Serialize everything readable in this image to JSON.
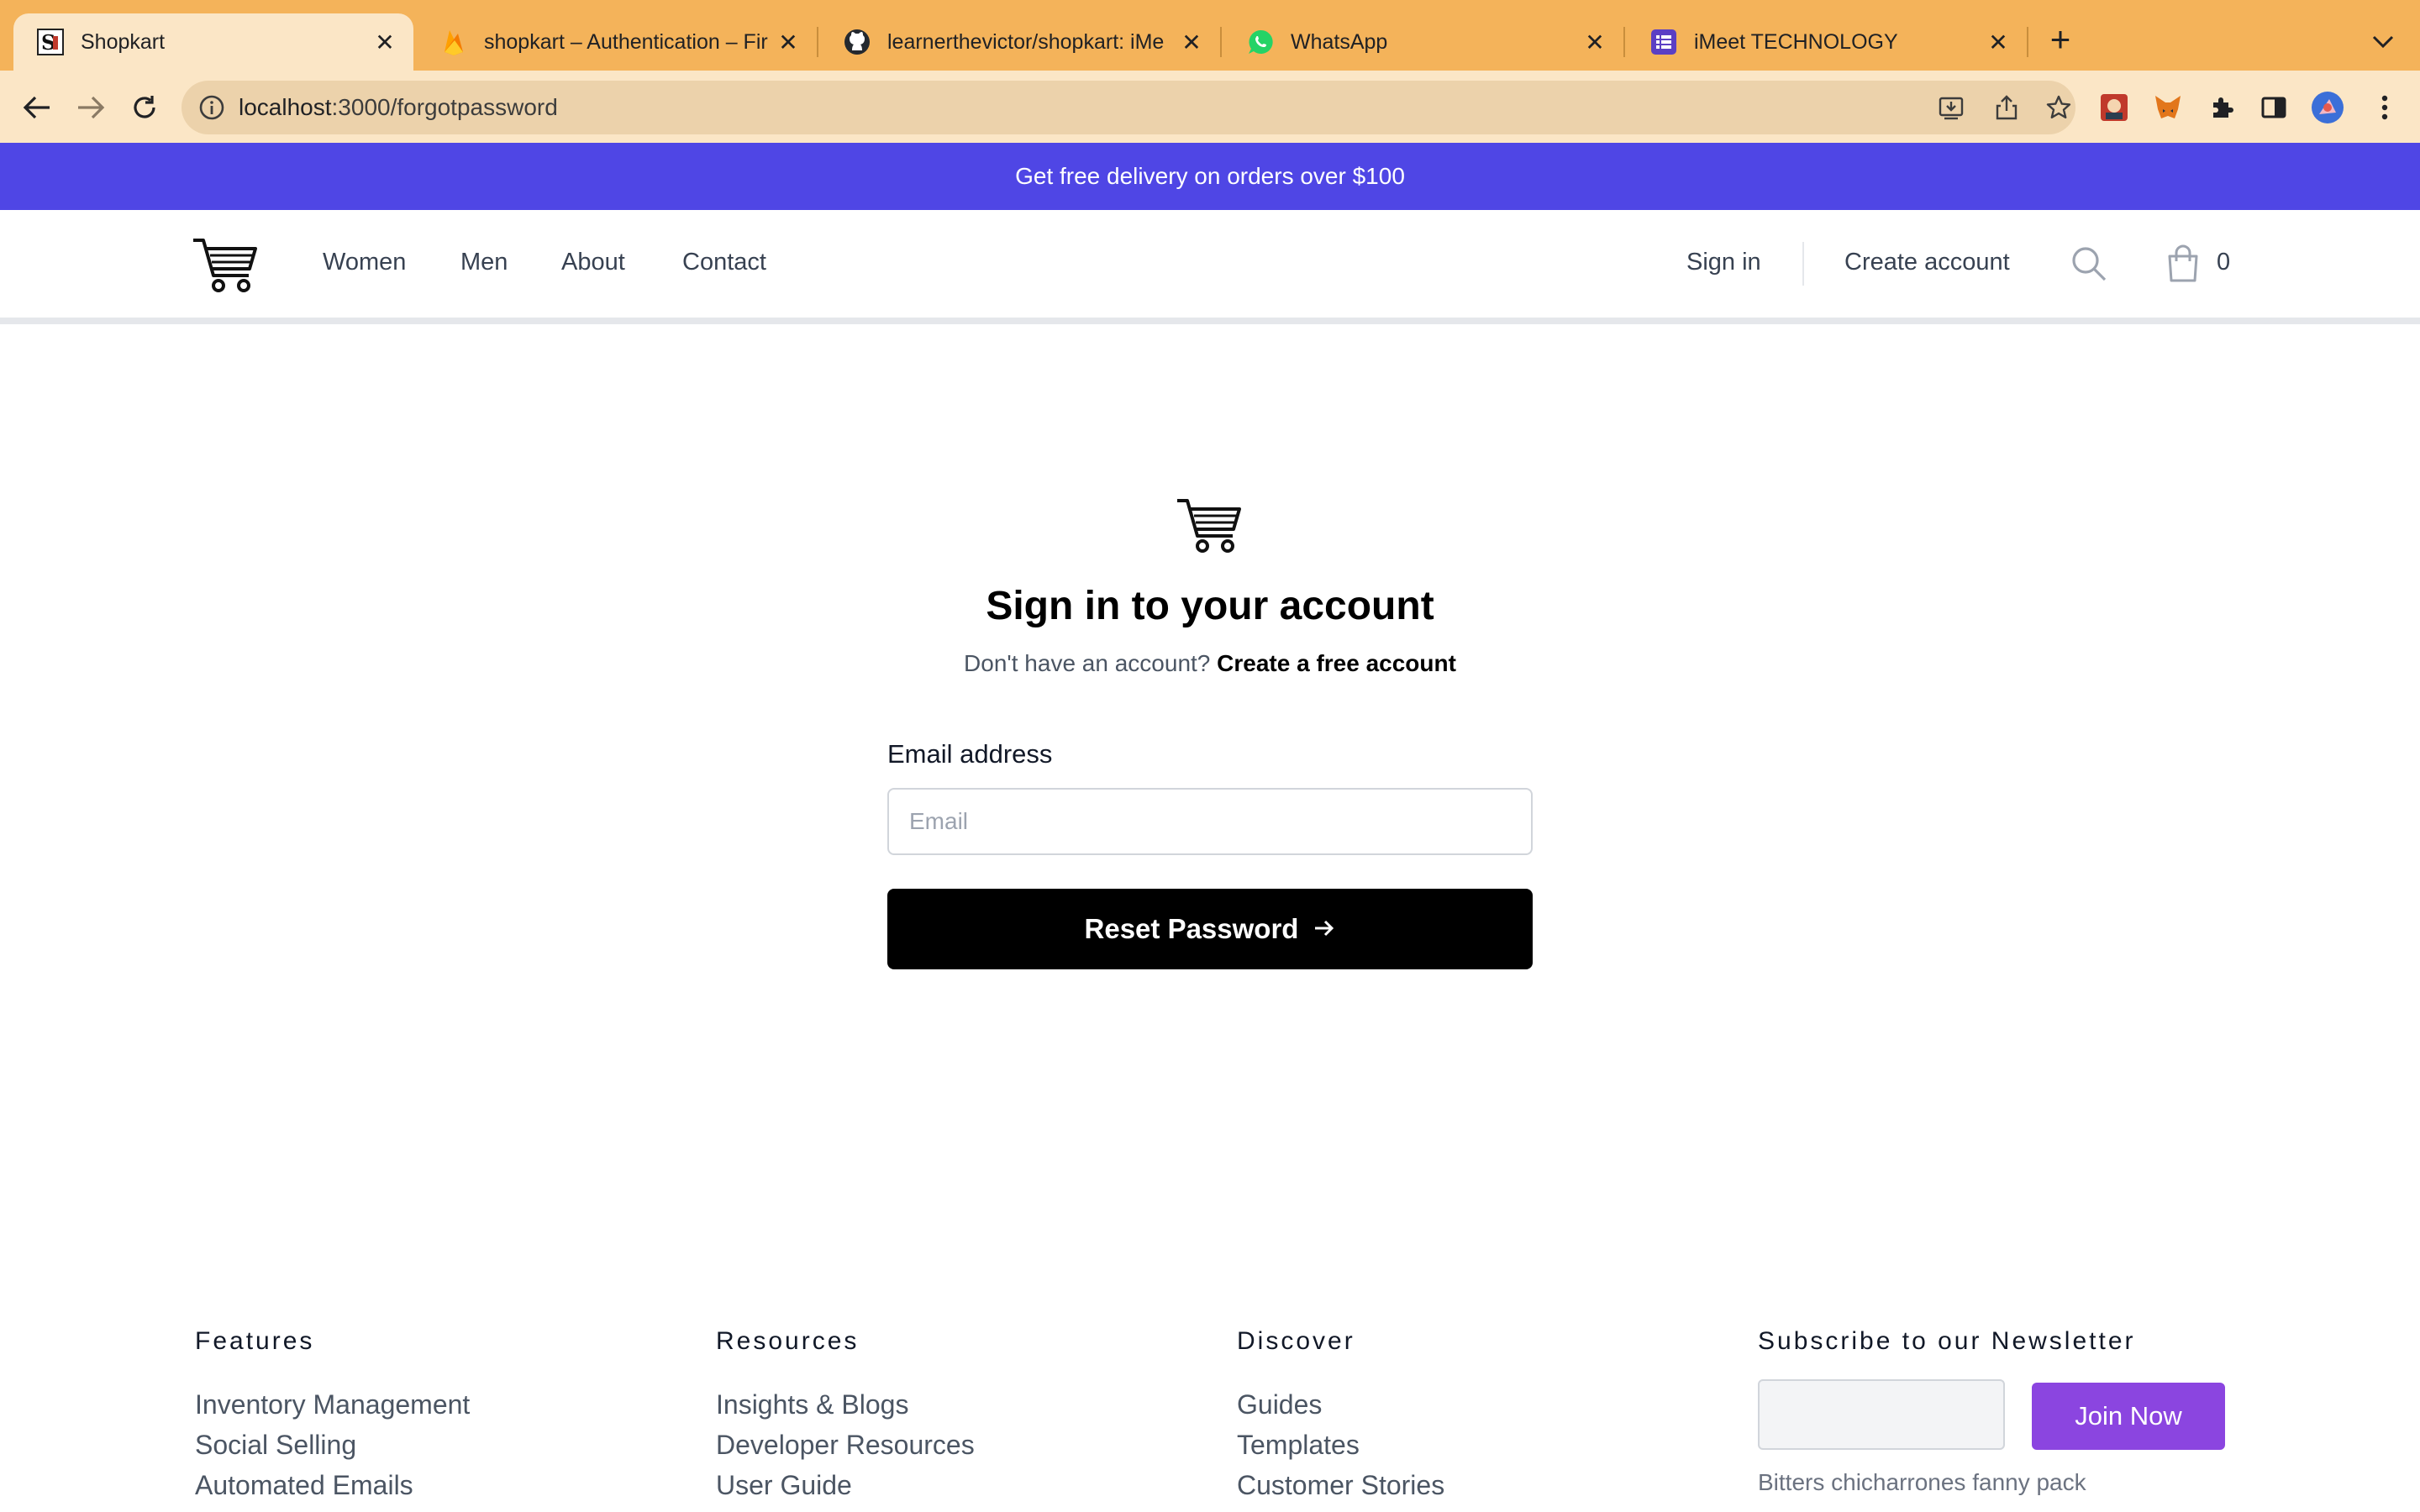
{
  "browser": {
    "tabs": [
      {
        "title": "Shopkart",
        "icon": "shopkart-favicon",
        "active": true
      },
      {
        "title": "shopkart – Authentication – Fir",
        "icon": "firebase-favicon",
        "active": false
      },
      {
        "title": "learnerthevictor/shopkart: iMe",
        "icon": "github-favicon",
        "active": false
      },
      {
        "title": "WhatsApp",
        "icon": "whatsapp-favicon",
        "active": false
      },
      {
        "title": "iMeet TECHNOLOGY",
        "icon": "imeet-favicon",
        "active": false
      }
    ],
    "url_host": "localhost",
    "url_rest": ":3000/forgotpassword",
    "colors": {
      "tabstrip": "#f4b35a",
      "toolbar": "#fbe6c6"
    }
  },
  "promo": {
    "text": "Get free delivery on orders over $100",
    "color": "#4f46e5"
  },
  "header": {
    "nav": [
      "Women",
      "Men",
      "About",
      "Contact"
    ],
    "sign_in": "Sign in",
    "create_account": "Create account",
    "cart_count": "0"
  },
  "auth": {
    "title": "Sign in to your account",
    "subtitle": "Don't have an account?",
    "subtitle_link": "Create a free account",
    "email_label": "Email address",
    "email_value": "",
    "email_placeholder": "Email",
    "submit_label": "Reset Password"
  },
  "footer": {
    "features": {
      "heading": "Features",
      "links": [
        "Inventory Management",
        "Social Selling",
        "Automated Emails"
      ]
    },
    "resources": {
      "heading": "Resources",
      "links": [
        "Insights & Blogs",
        "Developer Resources",
        "User Guide"
      ]
    },
    "discover": {
      "heading": "Discover",
      "links": [
        "Guides",
        "Templates",
        "Customer Stories"
      ]
    },
    "newsletter": {
      "heading": "Subscribe to our Newsletter",
      "button": "Join Now",
      "text": "Bitters chicharrones fanny pack",
      "button_color": "#8b45e0"
    }
  }
}
